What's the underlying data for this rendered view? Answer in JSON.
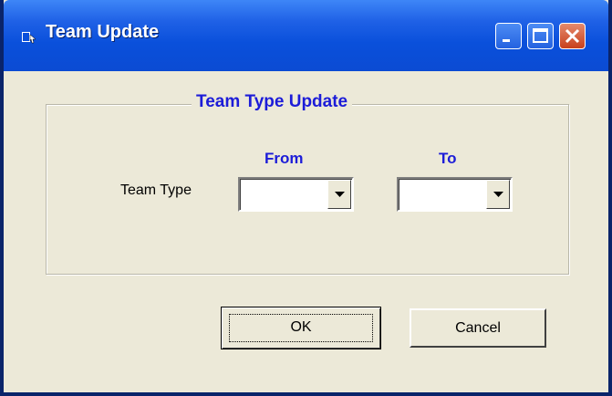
{
  "window": {
    "title": "Team Update",
    "title_bar_color": "#0a50db",
    "icon": "window-app-icon"
  },
  "title_buttons": {
    "minimize": "minimize-icon",
    "maximize": "maximize-icon",
    "close": "close-icon"
  },
  "frame": {
    "legend": "Team Type Update",
    "legend_color": "#1c1cd8"
  },
  "columns": {
    "from": "From",
    "to": "To"
  },
  "row": {
    "label": "Team Type",
    "from_value": "",
    "to_value": ""
  },
  "buttons": {
    "ok": "OK",
    "cancel": "Cancel"
  }
}
